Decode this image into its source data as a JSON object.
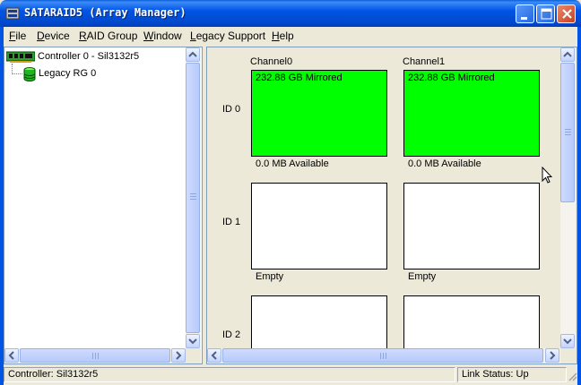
{
  "window": {
    "title": "SATARAID5 (Array Manager)",
    "colors": {
      "titlebar": "#0055e5",
      "used_disk": "#00ff00"
    }
  },
  "menu": [
    {
      "hotkey": "F",
      "rest": "ile"
    },
    {
      "hotkey": "D",
      "rest": "evice"
    },
    {
      "hotkey": "R",
      "rest": "AID Group"
    },
    {
      "hotkey": "W",
      "rest": "indow"
    },
    {
      "hotkey": "L",
      "rest": "egacy Support"
    },
    {
      "hotkey": "H",
      "rest": "elp"
    }
  ],
  "tree": {
    "controller": {
      "label": "Controller 0 - Sil3132r5",
      "icon": "controller-card-icon"
    },
    "group": {
      "label": "Legacy RG 0",
      "icon": "database-icon"
    }
  },
  "channels": [
    "Channel0",
    "Channel1"
  ],
  "ids": [
    "ID 0",
    "ID 1",
    "ID 2"
  ],
  "disks": {
    "id0": {
      "ch0": {
        "text": "232.88 GB Mirrored",
        "available": "0.0 MB Available",
        "used": true
      },
      "ch1": {
        "text": "232.88 GB Mirrored",
        "available": "0.0 MB Available",
        "used": true
      }
    },
    "id1": {
      "ch0": {
        "text": "",
        "available": "Empty",
        "used": false
      },
      "ch1": {
        "text": "",
        "available": "Empty",
        "used": false
      }
    },
    "id2": {
      "ch0": {
        "text": "",
        "available": "",
        "used": false
      },
      "ch1": {
        "text": "",
        "available": "",
        "used": false
      }
    }
  },
  "status": {
    "controller": "Controller: Sil3132r5",
    "link": "Link Status: Up"
  }
}
